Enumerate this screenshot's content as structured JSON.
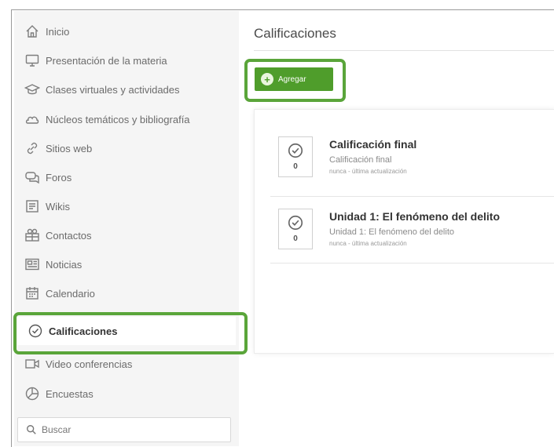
{
  "sidebar": {
    "items": [
      {
        "label": "Inicio",
        "icon": "home-icon"
      },
      {
        "label": "Presentación de la materia",
        "icon": "monitor-icon"
      },
      {
        "label": "Clases virtuales y actividades",
        "icon": "graduation-cap-icon"
      },
      {
        "label": "Núcleos temáticos y bibliografía",
        "icon": "cloud-icon"
      },
      {
        "label": "Sitios web",
        "icon": "link-icon"
      },
      {
        "label": "Foros",
        "icon": "chat-icon"
      },
      {
        "label": "Wikis",
        "icon": "wiki-icon"
      },
      {
        "label": "Contactos",
        "icon": "contacts-icon"
      },
      {
        "label": "Noticias",
        "icon": "news-icon"
      },
      {
        "label": "Calendario",
        "icon": "calendar-icon"
      },
      {
        "label": "Calificaciones",
        "icon": "check-circle-icon",
        "active": true
      },
      {
        "label": "Video conferencias",
        "icon": "video-icon"
      },
      {
        "label": "Encuestas",
        "icon": "poll-icon"
      }
    ],
    "search_placeholder": "Buscar"
  },
  "main": {
    "title": "Calificaciones",
    "add_button": "Agregar",
    "grades": [
      {
        "title": "Calificación final",
        "subtitle": "Calificación final",
        "meta": "nunca - última actualización",
        "count": "0"
      },
      {
        "title": "Unidad 1: El fenómeno del delito",
        "subtitle": "Unidad 1: El fenómeno del delito",
        "meta": "nunca - última actualización",
        "count": "0"
      }
    ]
  },
  "colors": {
    "accent": "#4f9d2b",
    "highlight": "#5aa53a",
    "sidebar_bg": "#f5f5f5"
  }
}
